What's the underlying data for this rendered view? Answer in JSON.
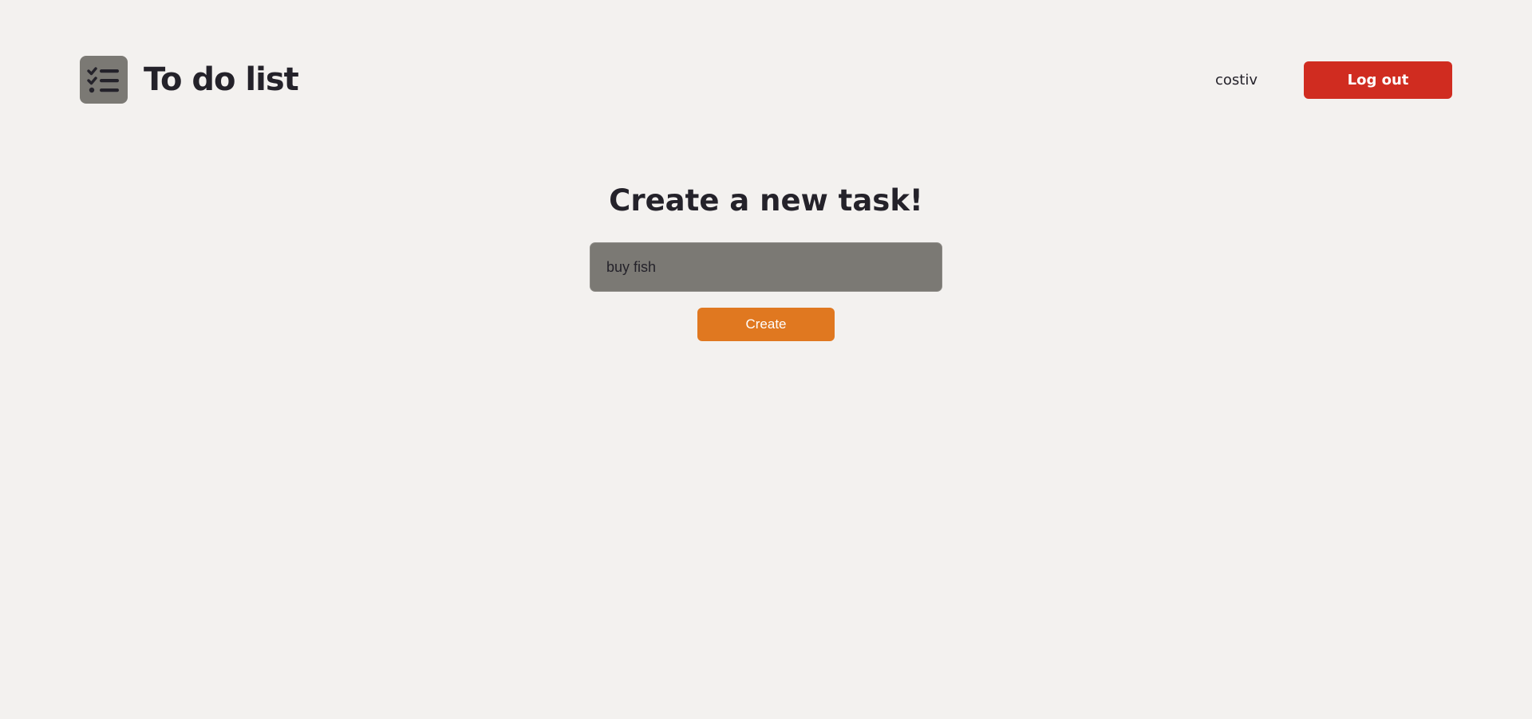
{
  "header": {
    "app_title": "To do list",
    "logo_icon": "checklist-icon",
    "username": "costiv",
    "logout_label": "Log out"
  },
  "main": {
    "title": "Create a new task!",
    "task_input": {
      "value": "buy fish",
      "placeholder": ""
    },
    "create_label": "Create"
  },
  "colors": {
    "background": "#f3f1ef",
    "text": "#24222a",
    "logout_button": "#d02c20",
    "create_button": "#e07820",
    "input_background": "#7b7974",
    "logo_background": "#7b7974"
  }
}
